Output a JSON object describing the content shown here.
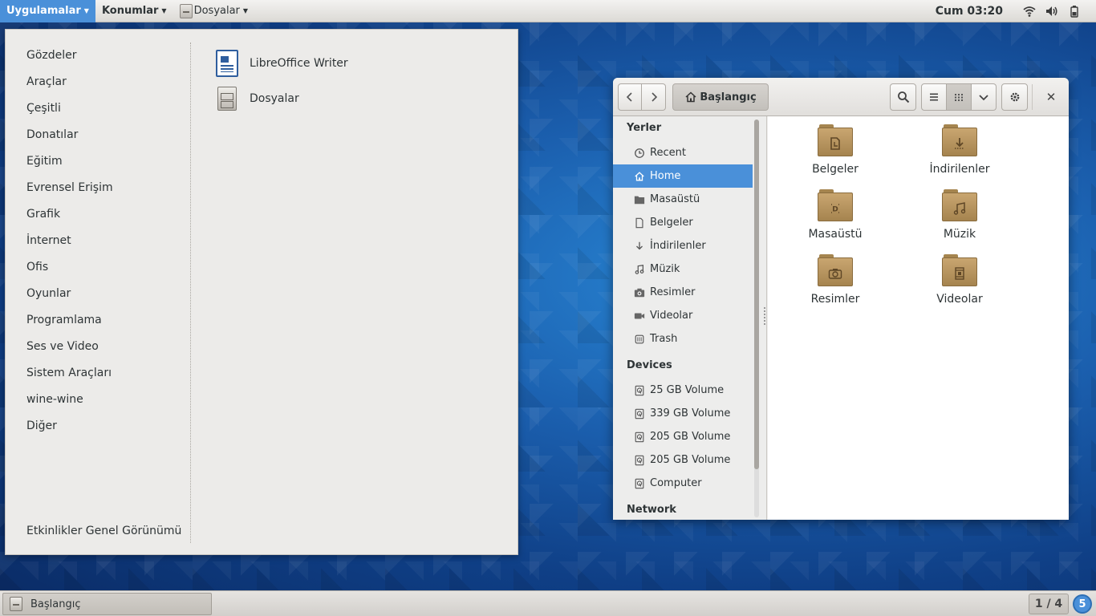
{
  "topbar": {
    "applications_label": "Uygulamalar",
    "places_label": "Konumlar",
    "app_label": "Dosyalar",
    "clock": "Cum 03:20"
  },
  "apps_menu": {
    "categories": [
      "Gözdeler",
      "Araçlar",
      "Çeşitli",
      "Donatılar",
      "Eğitim",
      "Evrensel Erişim",
      "Grafik",
      "İnternet",
      "Ofis",
      "Oyunlar",
      "Programlama",
      "Ses ve Video",
      "Sistem Araçları",
      "wine-wine",
      "Diğer"
    ],
    "activities_overview": "Etkinlikler Genel Görünümü",
    "apps": [
      "LibreOffice Writer",
      "Dosyalar"
    ]
  },
  "file_manager": {
    "path_label": "Başlangıç",
    "sidebar": {
      "places_heading": "Yerler",
      "places": [
        "Recent",
        "Home",
        "Masaüstü",
        "Belgeler",
        "İndirilenler",
        "Müzik",
        "Resimler",
        "Videolar",
        "Trash"
      ],
      "selected": "Home",
      "devices_heading": "Devices",
      "devices": [
        "25 GB Volume",
        "339 GB Volume",
        "205 GB Volume",
        "205 GB Volume",
        "Computer"
      ],
      "network_heading": "Network"
    },
    "folders": [
      "Belgeler",
      "İndirilenler",
      "Masaüstü",
      "Müzik",
      "Resimler",
      "Videolar"
    ]
  },
  "bottombar": {
    "task_label": "Başlangıç",
    "workspace": "1 / 4",
    "notifications": "5"
  },
  "colors": {
    "accent": "#4a90d9",
    "folder": "#b8955e"
  }
}
